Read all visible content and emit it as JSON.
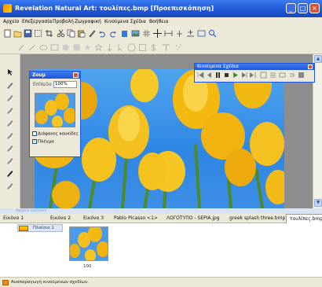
{
  "window": {
    "title": "Revelation Natural Art: τουλίπες.bmp [Προεπισκόπηση]",
    "min_label": "_",
    "max_label": "□",
    "close_label": "×"
  },
  "menu": {
    "items": [
      "Αρχείο",
      "Επεξεργασία",
      "Προβολή",
      "Ζωγραφική",
      "Κινούμενα Σχέδια",
      "Βοήθεια"
    ]
  },
  "toolbar_top": {
    "icons": [
      "new-icon",
      "open-icon",
      "save-icon",
      "select-icon",
      "crop-icon",
      "cut-icon",
      "copy-icon",
      "paste-icon",
      "pen-icon",
      "undo-icon",
      "redo-icon",
      "fill-icon",
      "picture-icon",
      "grid-icon",
      "crosshair-icon",
      "line-icon",
      "rotate-icon",
      "zoom-in-icon",
      "zoom-out-icon",
      "magnifier-icon"
    ]
  },
  "toolbar_second": {
    "icons": [
      "brush-icon",
      "line-tool-icon",
      "ellipse-icon",
      "rectangle-icon",
      "circle-icon",
      "square-icon",
      "star-icon",
      "star-outline-icon",
      "arrow-icon",
      "cursor-icon",
      "hexagon-icon",
      "shape-icon",
      "dollar-icon",
      "text-icon",
      "spray-icon"
    ]
  },
  "left_tools": [
    "pointer-icon",
    "pencil-icon",
    "brush-icon",
    "airbrush-icon",
    "fill-icon",
    "eraser-icon",
    "smudge-icon",
    "pen-tool-icon",
    "marker-icon",
    "blur-icon"
  ],
  "zoom_panel": {
    "title": "Ζουμ",
    "ratio_label": "Επίπεδο",
    "ratio_value": "100%",
    "option_light": "Διάφανες κουκίδες",
    "option_fit": "Πλέγμα"
  },
  "object_panel": {
    "title": "Κινούμενα Σχέδια"
  },
  "docbar_title": "Αρχεία εικόνων",
  "tabs": [
    {
      "label": "Εικόνα 1"
    },
    {
      "label": "Εικόνα 2"
    },
    {
      "label": "Εικόνα 3"
    },
    {
      "label": "Pablo Picasso <1>"
    },
    {
      "label": "ΛΟΓΟΤΥΠΟ - SEPIA.jpg"
    },
    {
      "label": "greek splash three.bmp"
    },
    {
      "label": "τουλίπες.bmp"
    }
  ],
  "layer": {
    "label": "Πλαίσιο 1"
  },
  "thumb": {
    "caption": "100"
  },
  "status": {
    "text": "Αναπαραγωγή κινούμενων σχεδίων."
  }
}
